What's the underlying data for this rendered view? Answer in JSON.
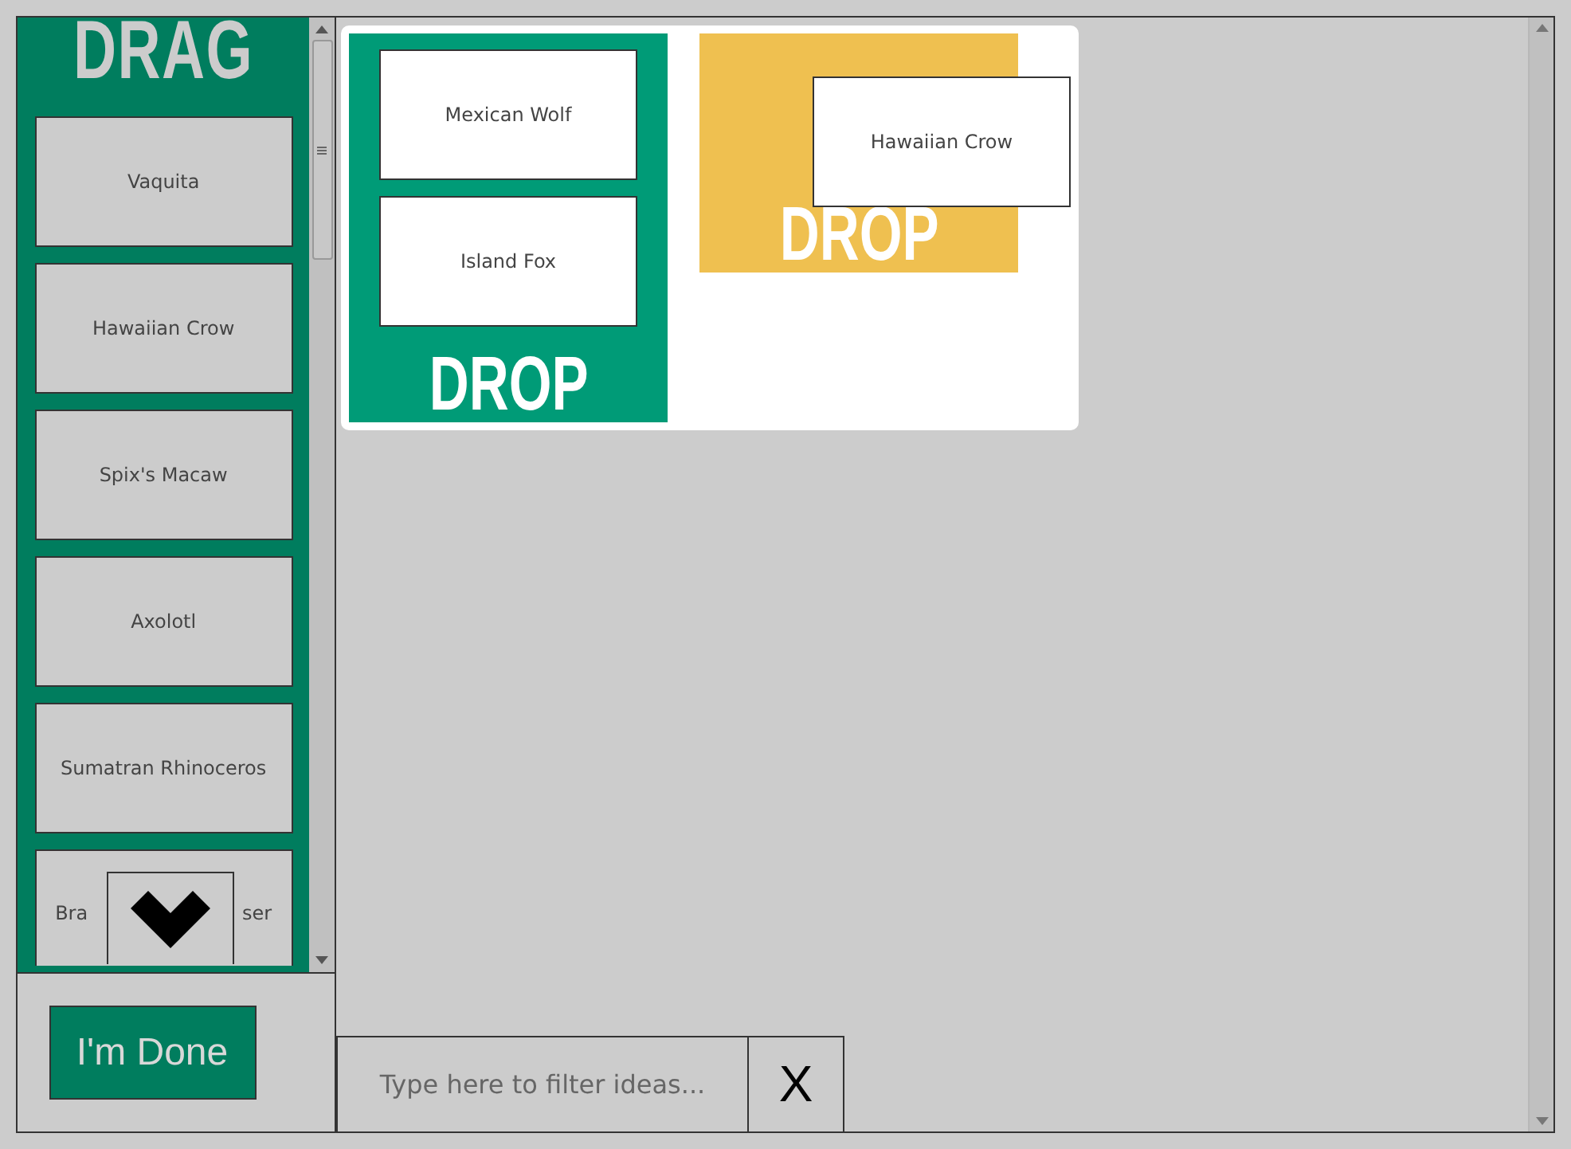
{
  "drag_panel": {
    "title": "DRAG",
    "ideas": [
      "Vaquita",
      "Hawaiian Crow",
      "Spix's Macaw",
      "Axolotl",
      "Sumatran Rhinoceros"
    ],
    "partial_idea": {
      "left": "Bra",
      "right": "ser"
    }
  },
  "done_button": "I'm Done",
  "drop_zones": [
    {
      "label": "DROP",
      "color": "#009b77",
      "cards": [
        "Mexican Wolf",
        "Island Fox"
      ]
    },
    {
      "label": "DROP",
      "color": "#efc050"
    }
  ],
  "dragged_card": "Hawaiian Crow",
  "filter": {
    "placeholder": "Type here to filter ideas...",
    "clear": "X"
  }
}
